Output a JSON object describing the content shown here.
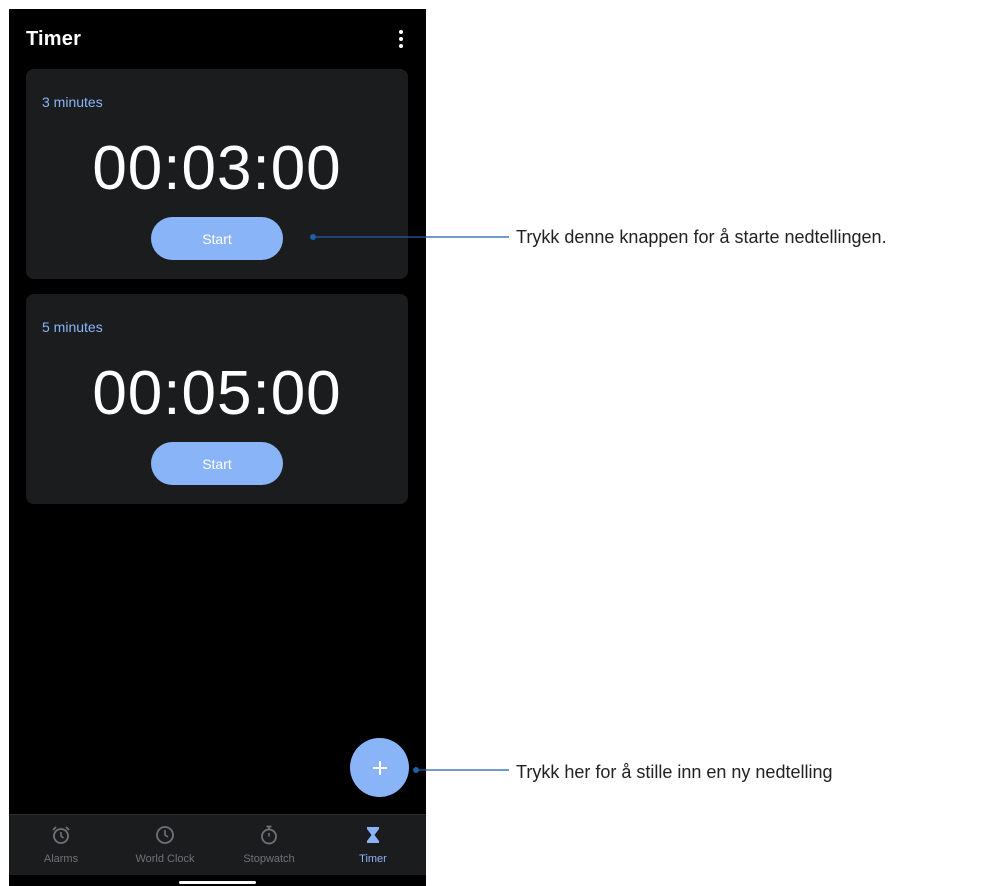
{
  "app": {
    "title": "Timer"
  },
  "timers": [
    {
      "label": "3 minutes",
      "time": "00:03:00",
      "start_label": "Start"
    },
    {
      "label": "5 minutes",
      "time": "00:05:00",
      "start_label": "Start"
    }
  ],
  "fab": {
    "icon": "plus-icon"
  },
  "bottom_nav": {
    "items": [
      {
        "label": "Alarms",
        "icon": "alarm-icon",
        "active": false
      },
      {
        "label": "World Clock",
        "icon": "clock-icon",
        "active": false
      },
      {
        "label": "Stopwatch",
        "icon": "stopwatch-icon",
        "active": false
      },
      {
        "label": "Timer",
        "icon": "hourglass-icon",
        "active": true
      }
    ]
  },
  "callouts": {
    "start_hint": "Trykk denne knappen for å starte nedtellingen.",
    "add_hint": "Trykk her for å stille inn en ny nedtelling"
  },
  "colors": {
    "accent": "#8ab4f8",
    "background": "#000000",
    "card": "#1b1c1e",
    "callout_line": "#1f5fa6"
  }
}
